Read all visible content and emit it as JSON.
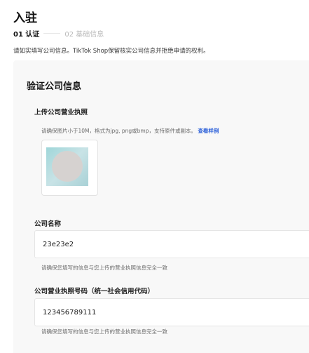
{
  "header": {
    "title": "入驻",
    "steps": [
      {
        "label": "01 认证"
      },
      {
        "label": "02 基础信息"
      }
    ],
    "notice": "请如实填写公司信息。TikTok Shop保留核实公司信息并拒绝申请的权利。"
  },
  "section": {
    "title": "验证公司信息",
    "upload": {
      "label": "上传公司营业执照",
      "hint": "请确保图片小于10M，格式为jpg, png或bmp，支持原件或副本。",
      "sample_link": "查看样例"
    },
    "company_name": {
      "label": "公司名称",
      "value": "23e23e2",
      "hint": "请确保您填写的信息与您上传的营业执照信息完全一致"
    },
    "license_number": {
      "label": "公司营业执照号码（统一社会信用代码）",
      "value": "123456789111",
      "hint": "请确保您填写的信息与您上传的营业执照信息完全一致"
    }
  },
  "colors": {
    "link": "#2b5fd9",
    "card_bg": "#f8f8f8"
  }
}
